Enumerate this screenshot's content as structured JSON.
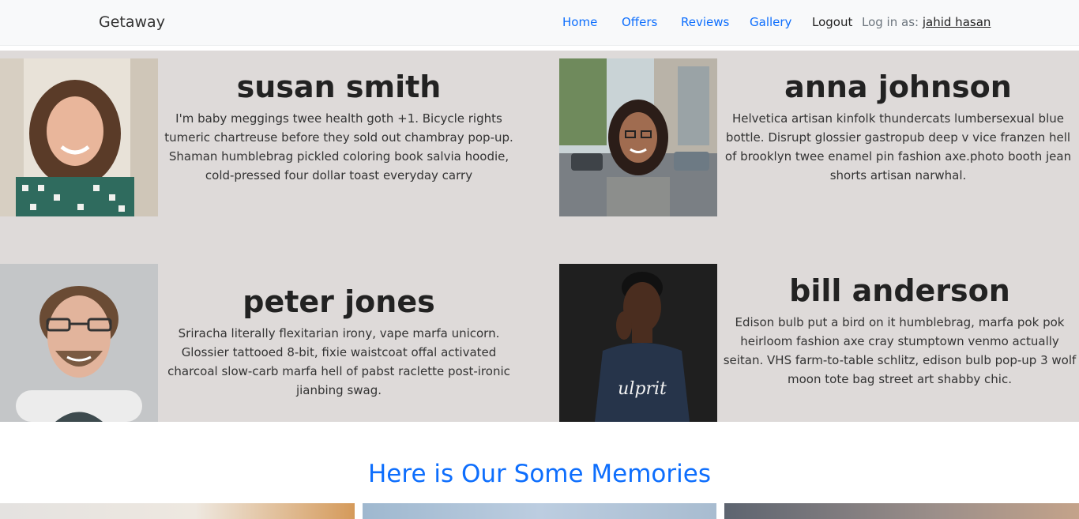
{
  "navbar": {
    "brand": "Getaway",
    "links": [
      "Home",
      "Offers",
      "Reviews",
      "Gallery"
    ],
    "logout": "Logout",
    "login_prefix": "Log in as:",
    "login_user": "jahid hasan"
  },
  "reviews": [
    {
      "name": "susan smith",
      "bio": "I'm baby meggings twee health goth +1. Bicycle rights tumeric chartreuse before they sold out chambray pop-up. Shaman humblebrag pickled coloring book salvia hoodie, cold-pressed four dollar toast everyday carry"
    },
    {
      "name": "anna johnson",
      "bio": "Helvetica artisan kinfolk thundercats lumbersexual blue bottle. Disrupt glossier gastropub deep v vice franzen hell of brooklyn twee enamel pin fashion axe.photo booth jean shorts artisan narwhal."
    },
    {
      "name": "peter jones",
      "bio": "Sriracha literally flexitarian irony, vape marfa unicorn. Glossier tattooed 8-bit, fixie waistcoat offal activated charcoal slow-carb marfa hell of pabst raclette post-ironic jianbing swag."
    },
    {
      "name": "bill anderson",
      "bio": "Edison bulb put a bird on it humblebrag, marfa pok pok heirloom fashion axe cray stumptown venmo actually seitan. VHS farm-to-table schlitz, edison bulb pop-up 3 wolf moon tote bag street art shabby chic."
    }
  ],
  "memories": {
    "title": "Here is Our Some Memories"
  },
  "colors": {
    "accent": "#0d6efd",
    "review_bg": "#dedad9",
    "navbar_bg": "#f8f9fa"
  }
}
